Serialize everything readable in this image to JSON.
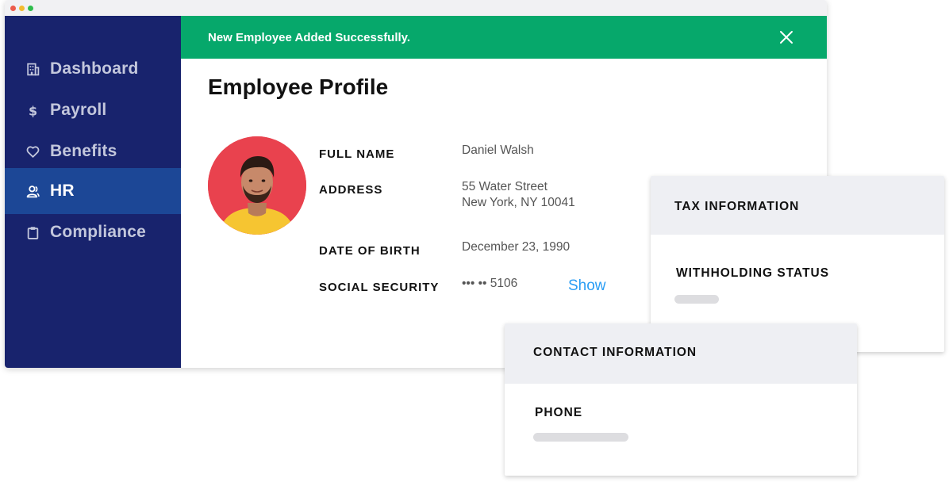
{
  "sidebar": {
    "items": [
      {
        "label": "Dashboard",
        "icon": "building-icon"
      },
      {
        "label": "Payroll",
        "icon": "dollar-icon"
      },
      {
        "label": "Benefits",
        "icon": "heart-icon"
      },
      {
        "label": "HR",
        "icon": "users-icon",
        "active": true
      },
      {
        "label": "Compliance",
        "icon": "clipboard-icon"
      }
    ]
  },
  "banner": {
    "message": "New Employee Added Successfully."
  },
  "profile": {
    "title": "Employee Profile",
    "full_name_label": "FULL NAME",
    "full_name": "Daniel Walsh",
    "address_label": "ADDRESS",
    "address_line1": "55 Water Street",
    "address_line2": "New York, NY 10041",
    "dob_label": "DATE OF BIRTH",
    "dob": "December 23, 1990",
    "ssn_label": "SOCIAL SECURITY",
    "ssn_masked": "••• •• 5106",
    "show_label": "Show"
  },
  "tax_card": {
    "title": "TAX INFORMATION",
    "field_label": "WITHHOLDING STATUS"
  },
  "contact_card": {
    "title": "CONTACT INFORMATION",
    "field_label": "PHONE"
  },
  "colors": {
    "sidebar": "#18236d",
    "sidebar_active": "#1c4796",
    "success": "#06a86b",
    "link": "#2a9df4"
  }
}
